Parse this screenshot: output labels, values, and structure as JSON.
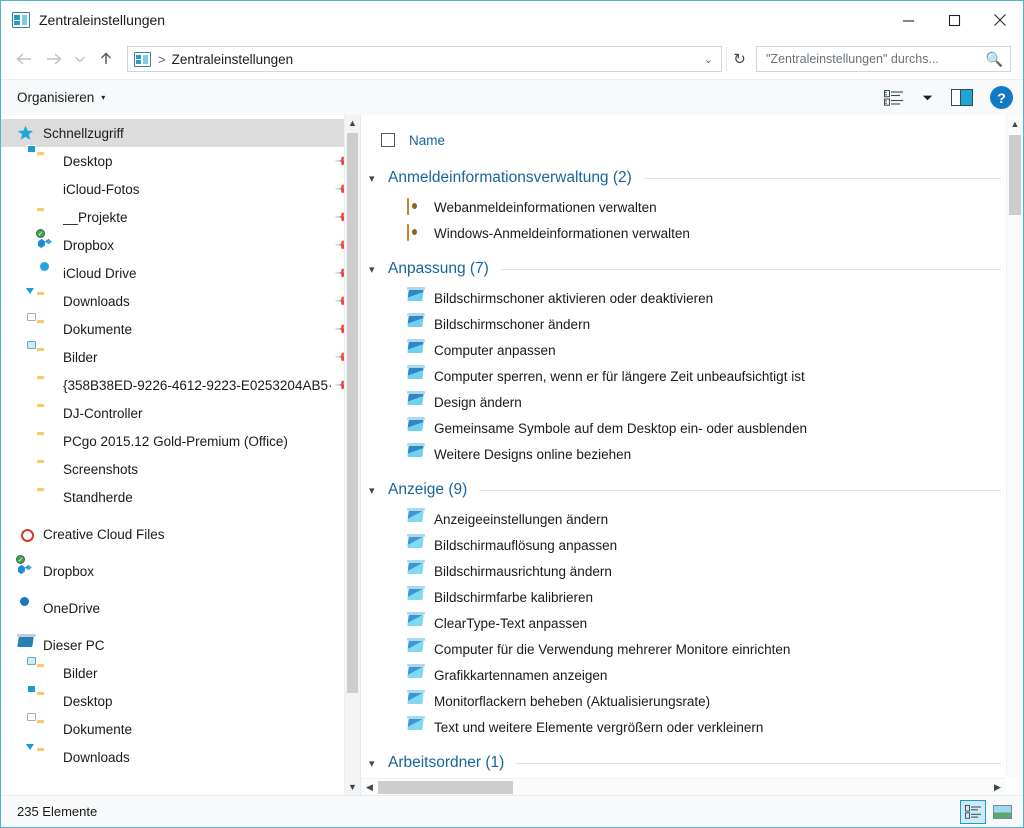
{
  "window": {
    "title": "Zentraleinstellungen",
    "app_icon": "control-panel-icon",
    "minimize_label": "–",
    "maximize_label": "□",
    "close_label": "×"
  },
  "address_bar": {
    "back_label": "←",
    "forward_label": "→",
    "recent_label": "⌄",
    "up_label": "↑",
    "separator": ">",
    "crumb": "Zentraleinstellungen",
    "dropdown_label": "⌄",
    "refresh_label": "↻"
  },
  "search": {
    "placeholder": "\"Zentraleinstellungen\" durchs...",
    "value": "",
    "icon": "magnifier-icon"
  },
  "toolbar": {
    "organize_label": "Organisieren",
    "organize_caret": "▾",
    "view_options_caret": "▾",
    "help_label": "?"
  },
  "sidebar": {
    "items": [
      {
        "label": "Schnellzugriff",
        "icon": "star-icon",
        "depth": 0,
        "pinned": false,
        "selected": true
      },
      {
        "label": "Desktop",
        "icon": "folder-desktop-icon",
        "depth": 1,
        "pinned": true,
        "selected": false
      },
      {
        "label": "iCloud-Fotos",
        "icon": "icloud-photos-icon",
        "depth": 1,
        "pinned": true,
        "selected": false
      },
      {
        "label": "__Projekte",
        "icon": "folder-icon",
        "depth": 1,
        "pinned": true,
        "selected": false
      },
      {
        "label": "Dropbox",
        "icon": "dropbox-icon",
        "depth": 1,
        "pinned": true,
        "selected": false
      },
      {
        "label": "iCloud Drive",
        "icon": "icloud-drive-icon",
        "depth": 1,
        "pinned": true,
        "selected": false
      },
      {
        "label": "Downloads",
        "icon": "folder-downloads-icon",
        "depth": 1,
        "pinned": true,
        "selected": false
      },
      {
        "label": "Dokumente",
        "icon": "folder-documents-icon",
        "depth": 1,
        "pinned": true,
        "selected": false
      },
      {
        "label": "Bilder",
        "icon": "folder-pictures-icon",
        "depth": 1,
        "pinned": true,
        "selected": false
      },
      {
        "label": "{358B38ED-9226-4612-9223-E0253204AB5·",
        "icon": "folder-icon",
        "depth": 1,
        "pinned": true,
        "selected": false
      },
      {
        "label": "DJ-Controller",
        "icon": "folder-icon",
        "depth": 1,
        "pinned": false,
        "selected": false
      },
      {
        "label": "PCgo 2015.12 Gold-Premium (Office)",
        "icon": "folder-icon",
        "depth": 1,
        "pinned": false,
        "selected": false
      },
      {
        "label": "Screenshots",
        "icon": "folder-icon",
        "depth": 1,
        "pinned": false,
        "selected": false
      },
      {
        "label": "Standherde",
        "icon": "folder-icon",
        "depth": 1,
        "pinned": false,
        "selected": false
      },
      {
        "label": "Creative Cloud Files",
        "icon": "creative-cloud-icon",
        "depth": 0,
        "pinned": false,
        "selected": false
      },
      {
        "label": "Dropbox",
        "icon": "dropbox-icon",
        "depth": 0,
        "pinned": false,
        "selected": false
      },
      {
        "label": "OneDrive",
        "icon": "onedrive-icon",
        "depth": 0,
        "pinned": false,
        "selected": false
      },
      {
        "label": "Dieser PC",
        "icon": "this-pc-icon",
        "depth": 0,
        "pinned": false,
        "selected": false
      },
      {
        "label": "Bilder",
        "icon": "folder-pictures-icon",
        "depth": 1,
        "pinned": false,
        "selected": false
      },
      {
        "label": "Desktop",
        "icon": "folder-desktop-icon",
        "depth": 1,
        "pinned": false,
        "selected": false
      },
      {
        "label": "Dokumente",
        "icon": "folder-documents-icon",
        "depth": 1,
        "pinned": false,
        "selected": false
      },
      {
        "label": "Downloads",
        "icon": "folder-downloads-icon",
        "depth": 1,
        "pinned": false,
        "selected": false
      }
    ]
  },
  "content": {
    "column_header": "Name",
    "groups": [
      {
        "title": "Anmeldeinformationsverwaltung (2)",
        "icon": "vault-icon",
        "items": [
          "Webanmeldeinformationen verwalten",
          "Windows-Anmeldeinformationen verwalten"
        ]
      },
      {
        "title": "Anpassung (7)",
        "icon": "monitor-icon",
        "items": [
          "Bildschirmschoner aktivieren oder deaktivieren",
          "Bildschirmschoner ändern",
          "Computer anpassen",
          "Computer sperren, wenn er für längere Zeit unbeaufsichtigt ist",
          "Design ändern",
          "Gemeinsame Symbole auf dem Desktop ein- oder ausblenden",
          "Weitere Designs online beziehen"
        ]
      },
      {
        "title": "Anzeige (9)",
        "icon": "monitor-flat-icon",
        "items": [
          "Anzeigeeinstellungen ändern",
          "Bildschirmauflösung anpassen",
          "Bildschirmausrichtung ändern",
          "Bildschirmfarbe kalibrieren",
          "ClearType-Text anpassen",
          "Computer für die Verwendung mehrerer Monitore einrichten",
          "Grafikkartennamen anzeigen",
          "Monitorflackern beheben (Aktualisierungsrate)",
          "Text und weitere Elemente vergrößern oder verkleinern"
        ]
      },
      {
        "title": "Arbeitsordner (1)",
        "icon": "monitor-flat-icon",
        "items": []
      }
    ]
  },
  "status_bar": {
    "item_count": "235 Elemente",
    "details_view_label": "Detailansicht",
    "large_icons_view_label": "Große Symbole"
  },
  "colors": {
    "window_border": "#4fb3d1",
    "accent_blue": "#18649c",
    "selection_gray": "#dcdcdc",
    "help_blue": "#1479c4",
    "folder_yellow": "#fcc860"
  }
}
